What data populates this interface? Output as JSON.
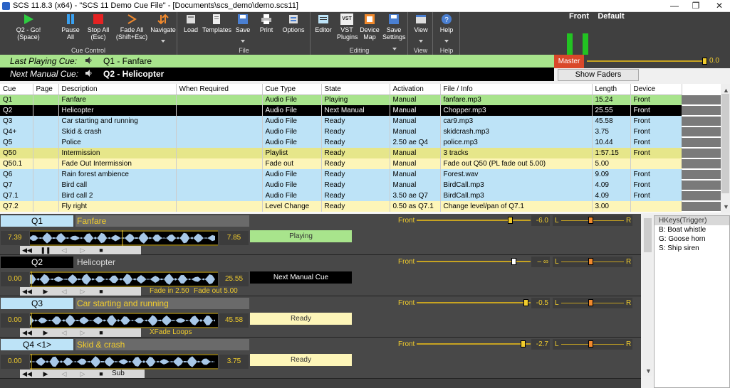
{
  "window": {
    "title": "SCS 11.8.3 (x64) - \"SCS 11 Demo Cue File\" - [Documents\\scs_demo\\demo.scs11]"
  },
  "ribbon": {
    "cue_control": [
      {
        "label": "Q2 - Go!\n(Space)"
      },
      {
        "label": "Pause\nAll"
      },
      {
        "label": "Stop All\n(Esc)"
      },
      {
        "label": "Fade All\n(Shift+Esc)"
      },
      {
        "label": "Navigate"
      }
    ],
    "cue_control_label": "Cue Control",
    "file": [
      {
        "label": "Load"
      },
      {
        "label": "Templates"
      },
      {
        "label": "Save"
      },
      {
        "label": "Print"
      },
      {
        "label": "Options"
      }
    ],
    "file_label": "File",
    "editing": [
      {
        "label": "Editor"
      },
      {
        "label": "VST\nPlugins"
      },
      {
        "label": "Device\nMap"
      },
      {
        "label": "Save\nSettings"
      }
    ],
    "editing_label": "Editing",
    "view": {
      "label": "View"
    },
    "view_label": "View",
    "help": {
      "label": "Help"
    },
    "help_label": "Help",
    "vst_badge": "VST"
  },
  "faders_header": {
    "front": "Front",
    "default": "Default"
  },
  "last_cue": {
    "label": "Last Playing Cue:",
    "value": "Q1 - Fanfare"
  },
  "next_cue": {
    "label": "Next Manual Cue:",
    "value": "Q2 - Helicopter"
  },
  "master": {
    "label": "Master",
    "value": "0.0"
  },
  "show_faders": "Show Faders",
  "grid": {
    "columns": [
      "Cue",
      "Page",
      "Description",
      "When Required",
      "Cue Type",
      "State",
      "Activation",
      "File / Info",
      "Length",
      "Device"
    ],
    "rows": [
      [
        "Q1",
        "",
        "Fanfare",
        "",
        "Audio File",
        "Playing",
        "Manual",
        "fanfare.mp3",
        "15.24",
        "Front"
      ],
      [
        "Q2",
        "",
        "Helicopter",
        "",
        "Audio File",
        "Next Manual",
        "Manual",
        "Chopper.mp3",
        "25.55",
        "Front"
      ],
      [
        "Q3",
        "",
        "Car starting and running",
        "",
        "Audio File",
        "Ready",
        "Manual",
        "car9.mp3",
        "45.58",
        "Front"
      ],
      [
        "Q4+",
        "",
        "Skid & crash",
        "",
        "Audio File",
        "Ready",
        "Manual",
        "skidcrash.mp3",
        "3.75",
        "Front"
      ],
      [
        "Q5",
        "",
        "Police",
        "",
        "Audio File",
        "Ready",
        "2.50 ae Q4",
        "police.mp3",
        "10.44",
        "Front"
      ],
      [
        "Q50",
        "",
        "Intermission",
        "",
        "Playlist",
        "Ready",
        "Manual",
        "3 tracks",
        "1:57.15",
        "Front"
      ],
      [
        "Q50.1",
        "",
        "Fade Out Intermission",
        "",
        "Fade out",
        "Ready",
        "Manual",
        "Fade out Q50  (PL fade out 5.00)",
        "5.00",
        ""
      ],
      [
        "Q6",
        "",
        "Rain forest ambience",
        "",
        "Audio File",
        "Ready",
        "Manual",
        "Forest.wav",
        "9.09",
        "Front"
      ],
      [
        "Q7",
        "",
        "Bird call",
        "",
        "Audio File",
        "Ready",
        "Manual",
        "BirdCall.mp3",
        "4.09",
        "Front"
      ],
      [
        "Q7.1",
        "",
        "Bird call 2",
        "",
        "Audio File",
        "Ready",
        "3.50 ae Q7",
        "BirdCall.mp3",
        "4.09",
        "Front"
      ],
      [
        "Q7.2",
        "",
        "Fly right",
        "",
        "Level Change",
        "Ready",
        "0.50 as Q7.1",
        "Change level/pan of Q7.1",
        "3.00",
        ""
      ]
    ],
    "row_colors": [
      "#a8e48c",
      "#000000",
      "#bde3f7",
      "#bde3f7",
      "#bde3f7",
      "#e6e68a",
      "#fdf5b8",
      "#bde3f7",
      "#bde3f7",
      "#bde3f7",
      "#fdf5b8"
    ]
  },
  "panels": [
    {
      "cue": "Q1",
      "title": "Fanfare",
      "start": "7.39",
      "end": "7.85",
      "status": "Playing",
      "status_color": "#a8e48c",
      "front": "Front",
      "level": "-6.0",
      "L": "L",
      "R": "R",
      "extra1": "",
      "extra2": ""
    },
    {
      "cue": "Q2",
      "title": "Helicopter",
      "start": "0.00",
      "end": "25.55",
      "status": "Next Manual Cue",
      "status_color": "#000000",
      "front": "Front",
      "level": "– ∞",
      "L": "L",
      "R": "R",
      "extra1": "Fade in 2.50",
      "extra2": "Fade out 5.00"
    },
    {
      "cue": "Q3",
      "title": "Car starting and running",
      "start": "0.00",
      "end": "45.58",
      "status": "Ready",
      "status_color": "#fdf5b8",
      "front": "Front",
      "level": "-0.5",
      "L": "L",
      "R": "R",
      "extra1": "XFade Loops",
      "extra2": ""
    },
    {
      "cue": "Q4 <1>",
      "title": "Skid & crash",
      "start": "0.00",
      "end": "3.75",
      "status": "Ready",
      "status_color": "#fdf5b8",
      "front": "Front",
      "level": "-2.7",
      "L": "L",
      "R": "R",
      "extra1": "Sub",
      "extra2": ""
    }
  ],
  "hotkeys": {
    "title": "HKeys(Trigger)",
    "items": [
      "B: Boat whistle",
      "G: Goose horn",
      "S: Ship siren"
    ]
  }
}
